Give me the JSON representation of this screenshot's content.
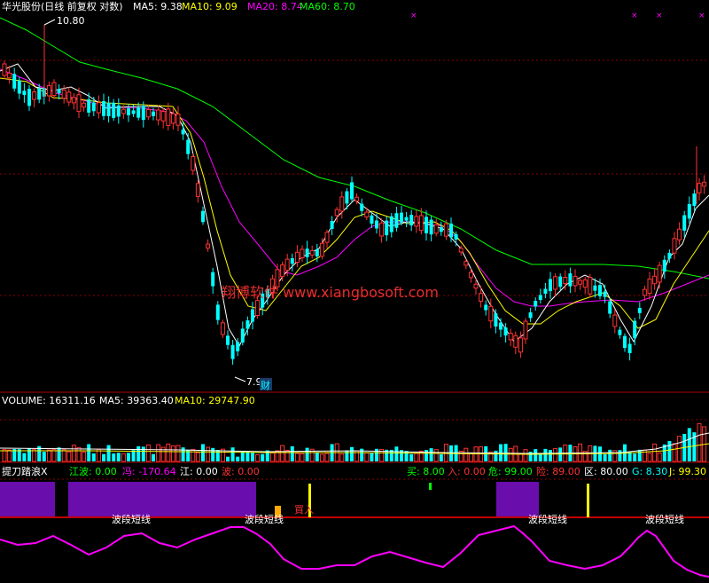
{
  "header": {
    "title": "华光股份(日线 前复权 对数)",
    "ma": [
      {
        "label": "MA5:",
        "value": "9.38",
        "color": "#ffffff"
      },
      {
        "label": "MA10:",
        "value": "9.09",
        "color": "#ffff00"
      },
      {
        "label": "MA20:",
        "value": "8.74",
        "color": "#ff00ff"
      },
      {
        "label": "MA60:",
        "value": "8.70",
        "color": "#00ff00"
      }
    ],
    "high_marker": "10.80",
    "low_marker": "7.96",
    "cai_tag": "财"
  },
  "volume_header": [
    {
      "label": "VOLUME:",
      "value": "16311.16",
      "color": "#ffffff"
    },
    {
      "label": "MA5:",
      "value": "39363.40",
      "color": "#ffffff"
    },
    {
      "label": "MA10:",
      "value": "29747.90",
      "color": "#ffff00"
    }
  ],
  "indicator_header": {
    "name": "提刀踏浪X",
    "left": [
      {
        "label": "江波:",
        "value": "0.00",
        "color": "#00ff00"
      },
      {
        "label": "冯:",
        "value": "-170.64",
        "color": "#ff00ff"
      },
      {
        "label": "江:",
        "value": "0.00",
        "color": "#ffffff"
      },
      {
        "label": "波:",
        "value": "0.00",
        "color": "#ff3333"
      }
    ],
    "right": [
      {
        "label": "买:",
        "value": "8.00",
        "color": "#00ff00"
      },
      {
        "label": "入:",
        "value": "0.00",
        "color": "#ff3333"
      },
      {
        "label": "危:",
        "value": "99.00",
        "color": "#00ff00"
      },
      {
        "label": "险:",
        "value": "89.00",
        "color": "#ff3333"
      },
      {
        "label": "区:",
        "value": "80.00",
        "color": "#ffffff"
      },
      {
        "label": "G:",
        "value": "8.30",
        "color": "#00ffff"
      },
      {
        "label": "J:",
        "value": "99.30",
        "color": "#ffff00"
      }
    ]
  },
  "watermark": "翔博软件 www.xiangbosoft.com",
  "signal_labels": [
    "波段短线",
    "波段短线",
    "波段短线",
    "波段短线"
  ],
  "buy_label": "買入",
  "colors": {
    "up": "#ff3333",
    "down": "#00ffff",
    "ma5": "#ffffff",
    "ma10": "#ffff00",
    "ma20": "#ff00ff",
    "ma60": "#00ff00",
    "grid": "#8b0000",
    "purple_band": "#6a0dad",
    "osc": "#ff00ff"
  }
}
